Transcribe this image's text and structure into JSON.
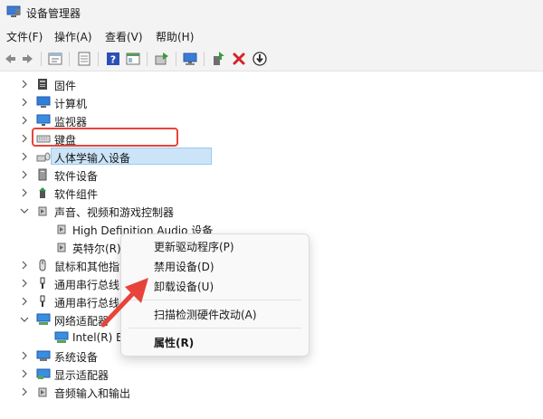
{
  "window": {
    "title": "设备管理器"
  },
  "menubar": [
    {
      "label": "文件(F)"
    },
    {
      "label": "操作(A)"
    },
    {
      "label": "查看(V)"
    },
    {
      "label": "帮助(H)"
    }
  ],
  "tree": {
    "items": [
      {
        "label": "固件",
        "icon": "firmware-icon"
      },
      {
        "label": "计算机",
        "icon": "computer-icon"
      },
      {
        "label": "监视器",
        "icon": "monitor-icon"
      },
      {
        "label": "键盘",
        "icon": "keyboard-icon"
      },
      {
        "label": "人体学输入设备",
        "icon": "hid-icon"
      },
      {
        "label": "软件设备",
        "icon": "software-device-icon"
      },
      {
        "label": "软件组件",
        "icon": "software-component-icon"
      },
      {
        "label": "声音、视频和游戏控制器",
        "icon": "speaker-icon"
      },
      {
        "label": "High Definition Audio 设备",
        "icon": "speaker-icon"
      },
      {
        "label": "英特尔(R)",
        "icon": "speaker-icon"
      },
      {
        "label": "鼠标和其他指",
        "icon": "mouse-icon"
      },
      {
        "label": "通用串行总线",
        "icon": "usb-icon"
      },
      {
        "label": "通用串行总线",
        "icon": "usb-icon"
      },
      {
        "label": "网络适配器",
        "icon": "network-icon"
      },
      {
        "label": "Intel(R) E",
        "icon": "network-icon"
      },
      {
        "label": "系统设备",
        "icon": "system-icon"
      },
      {
        "label": "显示适配器",
        "icon": "display-adapter-icon"
      },
      {
        "label": "音频输入和输出",
        "icon": "audio-io-icon"
      }
    ]
  },
  "context_menu": {
    "items": [
      {
        "label": "更新驱动程序(P)"
      },
      {
        "label": "禁用设备(D)"
      },
      {
        "label": "卸载设备(U)"
      },
      {
        "label": "扫描检测硬件改动(A)"
      },
      {
        "label": "属性(R)"
      }
    ]
  },
  "colors": {
    "highlight_box": "#e8433a",
    "selection": "#cce4f7",
    "arrow": "#e8433a"
  }
}
